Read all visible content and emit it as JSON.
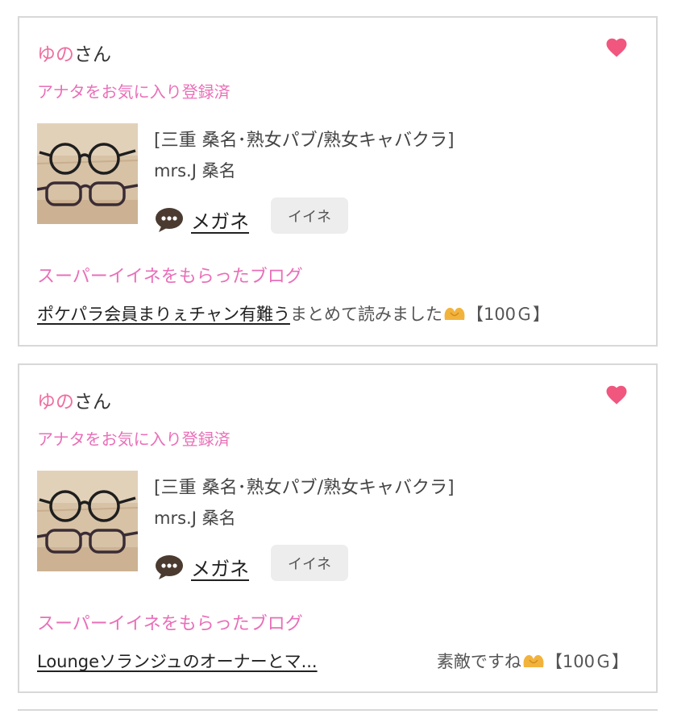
{
  "colors": {
    "pink_name": "#ee6fa0",
    "pink_label": "#e96fb8",
    "heart": "#f0567e",
    "border": "#d8d8d8",
    "button_bg": "#ededed"
  },
  "icons": {
    "heart": "heart-icon",
    "comment": "speech-bubble-icon",
    "hands": "heart-hands-emoji"
  },
  "cards": [
    {
      "user_name": "ゆの",
      "user_suffix": "さん",
      "favorite_status": "アナタをお気に入り登録済",
      "shop_category": "[三重 桑名･熟女パブ/熟女キャバクラ]",
      "shop_name": "mrs.J 桑名",
      "topic": "メガネ",
      "like_button": "イイネ",
      "super_heading": "スーパーイイネをもらったブログ",
      "blog_title": "ポケパラ会員まりぇチャン有難う",
      "blog_comment": "まとめて読みました",
      "blog_points": "【100Ｇ】"
    },
    {
      "user_name": "ゆの",
      "user_suffix": "さん",
      "favorite_status": "アナタをお気に入り登録済",
      "shop_category": "[三重 桑名･熟女パブ/熟女キャバクラ]",
      "shop_name": "mrs.J 桑名",
      "topic": "メガネ",
      "like_button": "イイネ",
      "super_heading": "スーパーイイネをもらったブログ",
      "blog_title": "Loungeソランジュのオーナーとマ...",
      "blog_comment": "素敵ですね",
      "blog_points": "【100Ｇ】"
    }
  ]
}
